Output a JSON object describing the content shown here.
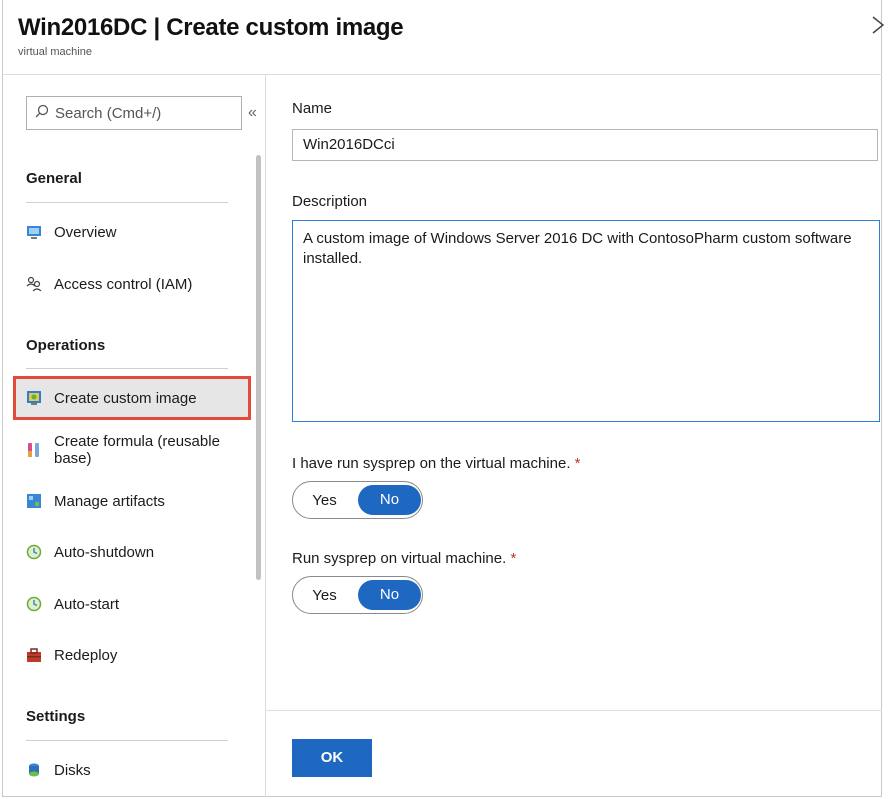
{
  "header": {
    "title": "Win2016DC | Create custom image",
    "subtitle": "virtual machine",
    "close_icon": "close-icon"
  },
  "sidebar": {
    "search_placeholder": "Search (Cmd+/)",
    "collapse_glyph": "«",
    "sections": {
      "general": "General",
      "operations": "Operations",
      "settings": "Settings"
    },
    "items": [
      {
        "label": "Overview",
        "icon": "vm-icon"
      },
      {
        "label": "Access control (IAM)",
        "icon": "people-icon"
      },
      {
        "label": "Create custom image",
        "icon": "image-icon",
        "selected": true
      },
      {
        "label": "Create formula (reusable base)",
        "icon": "formula-icon"
      },
      {
        "label": "Manage artifacts",
        "icon": "artifact-icon"
      },
      {
        "label": "Auto-shutdown",
        "icon": "clock-icon"
      },
      {
        "label": "Auto-start",
        "icon": "clock-icon"
      },
      {
        "label": "Redeploy",
        "icon": "toolbox-icon"
      },
      {
        "label": "Disks",
        "icon": "disk-icon"
      }
    ]
  },
  "form": {
    "name_label": "Name",
    "name_value": "Win2016DCci",
    "description_label": "Description",
    "description_value": "A custom image of Windows Server 2016 DC with ContosoPharm custom software installed.",
    "sysprep_run_label": "I have run sysprep on the virtual machine.",
    "sysprep_run_options": [
      "Yes",
      "No"
    ],
    "sysprep_run_selected": "No",
    "sysprep_do_label": "Run sysprep on virtual machine.",
    "sysprep_do_options": [
      "Yes",
      "No"
    ],
    "sysprep_do_selected": "No",
    "required_marker": "*",
    "ok_label": "OK"
  },
  "colors": {
    "accent": "#1f68c2",
    "selection_outline": "#e24b3b",
    "required": "#c4362b"
  }
}
